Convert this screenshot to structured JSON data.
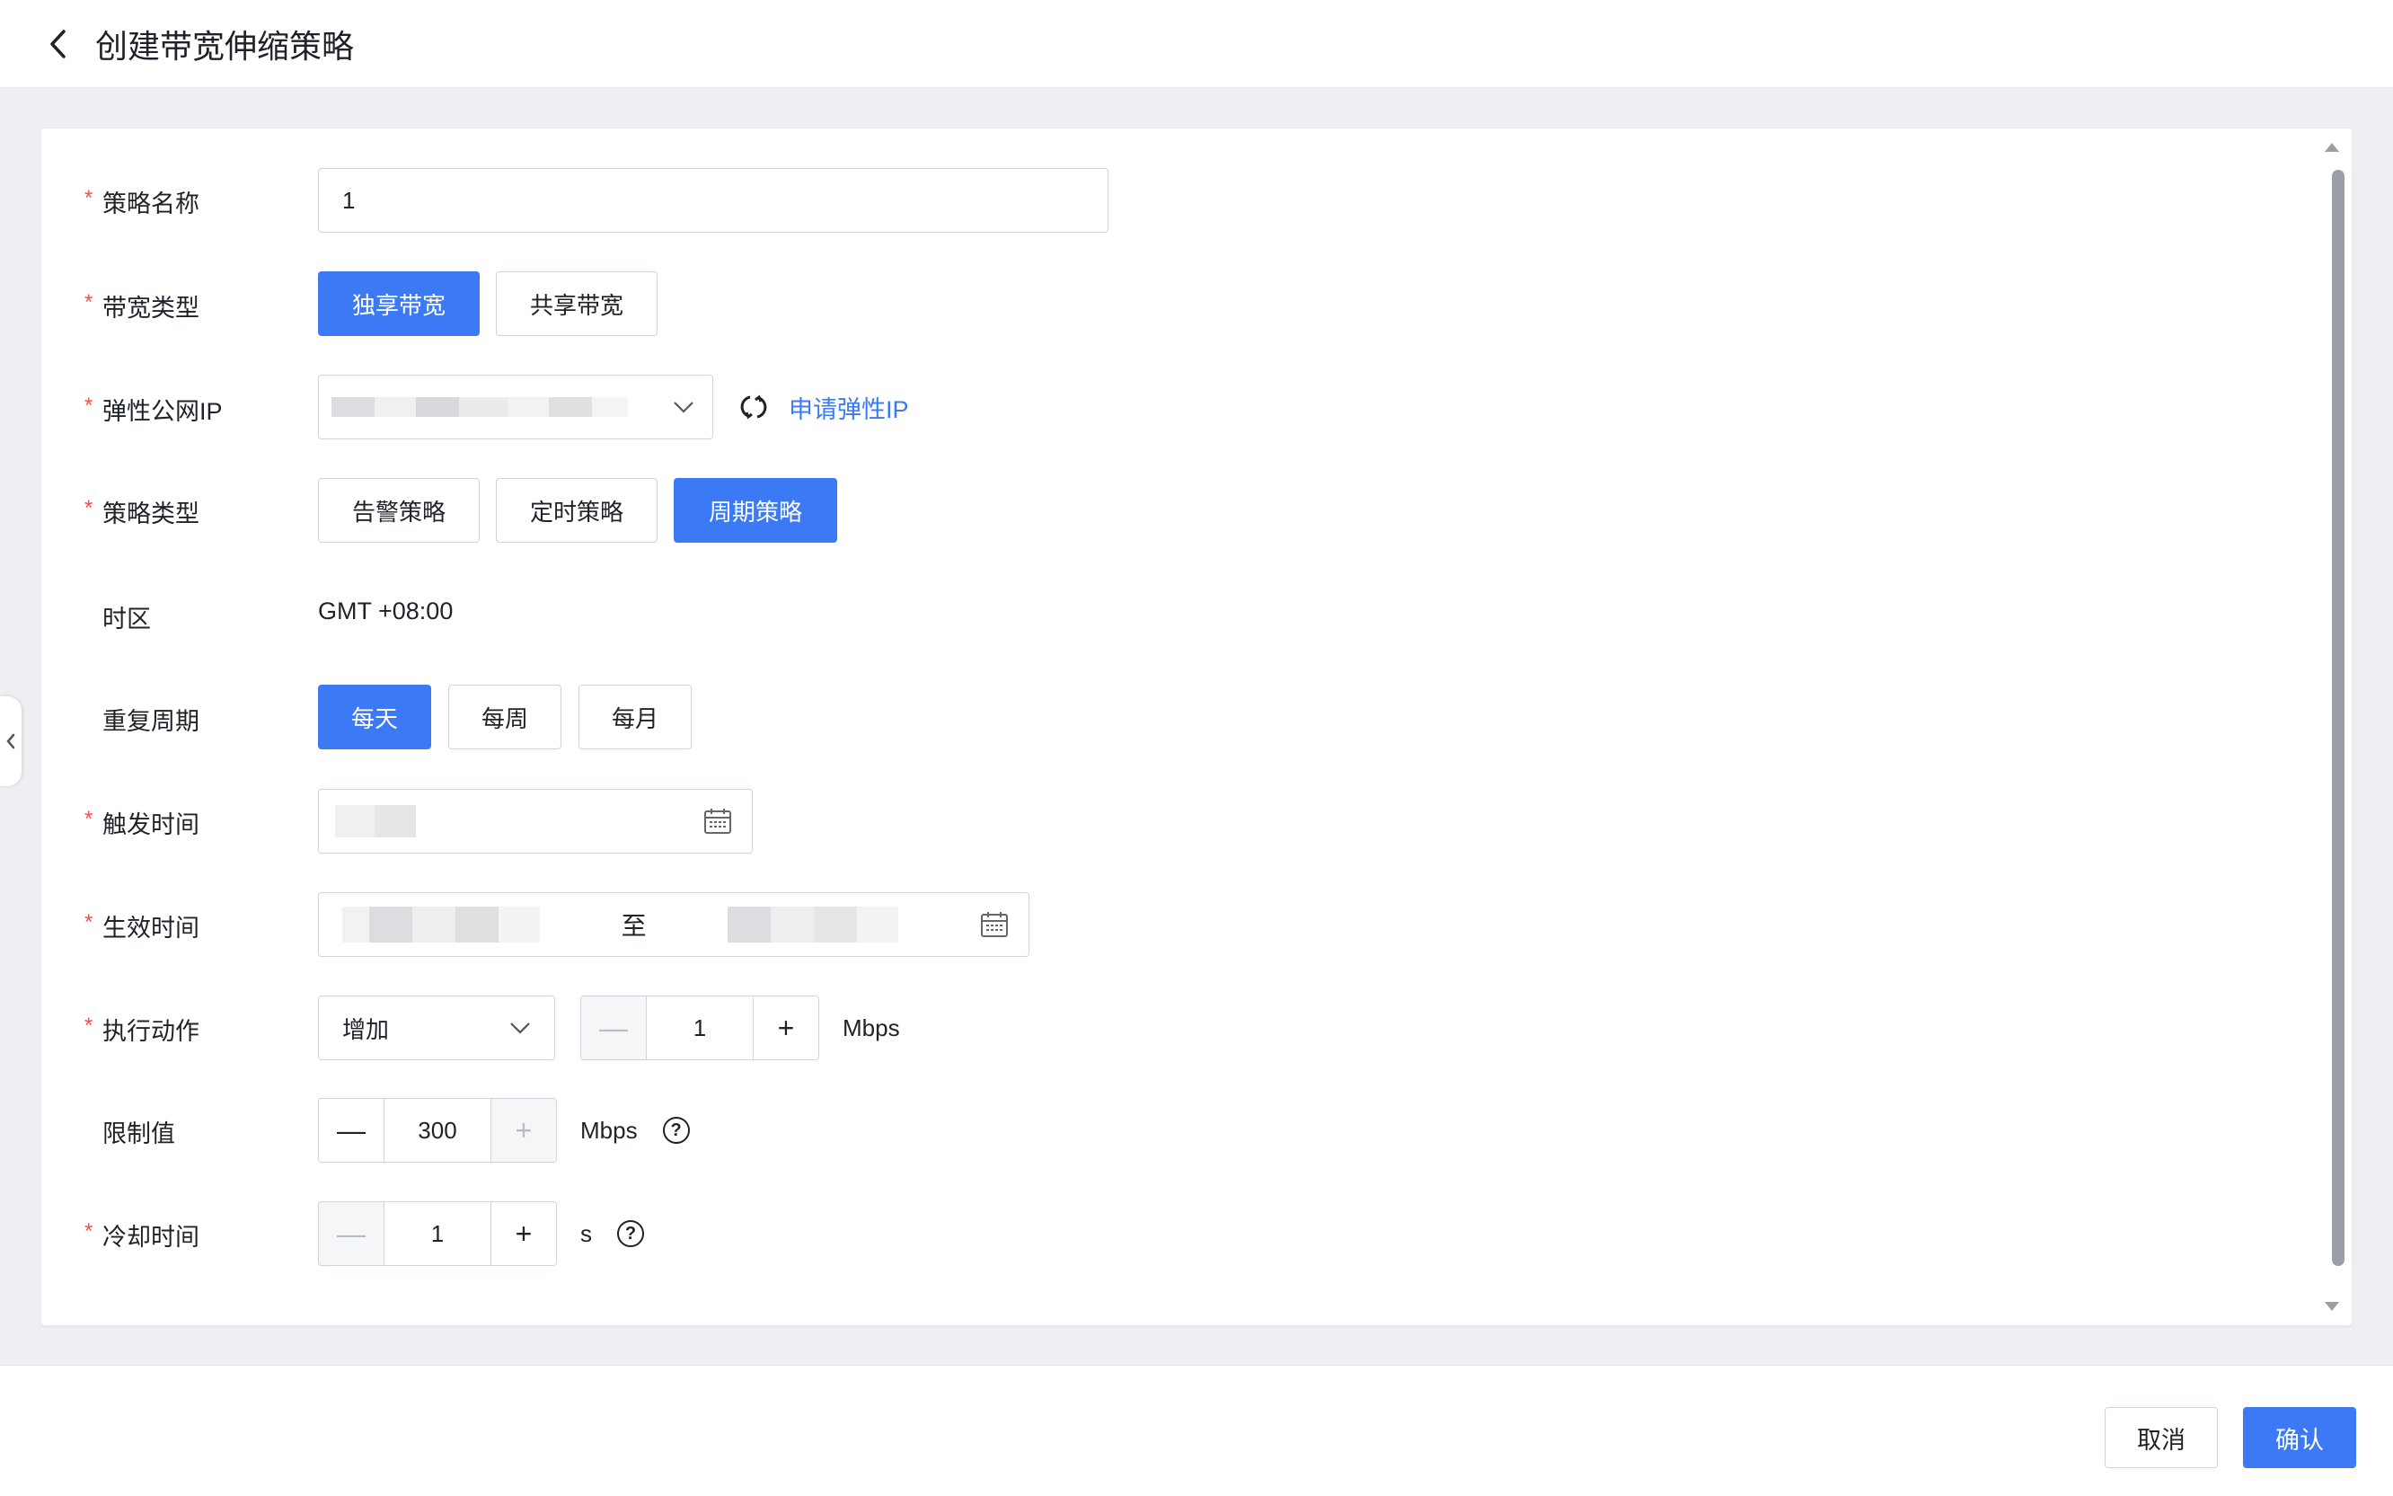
{
  "header": {
    "title": "创建带宽伸缩策略"
  },
  "form": {
    "policy_name": {
      "label": "策略名称",
      "value": "1"
    },
    "bandwidth_type": {
      "label": "带宽类型",
      "options": [
        "独享带宽",
        "共享带宽"
      ],
      "selected": "独享带宽"
    },
    "eip": {
      "label": "弹性公网IP",
      "apply_link": "申请弹性IP"
    },
    "policy_type": {
      "label": "策略类型",
      "options": [
        "告警策略",
        "定时策略",
        "周期策略"
      ],
      "selected": "周期策略"
    },
    "timezone": {
      "label": "时区",
      "value": "GMT +08:00"
    },
    "repeat_cycle": {
      "label": "重复周期",
      "options": [
        "每天",
        "每周",
        "每月"
      ],
      "selected": "每天"
    },
    "trigger_time": {
      "label": "触发时间"
    },
    "effective_time": {
      "label": "生效时间",
      "separator": "至"
    },
    "action": {
      "label": "执行动作",
      "selected": "增加",
      "amount": "1",
      "unit": "Mbps"
    },
    "limit": {
      "label": "限制值",
      "value": "300",
      "unit": "Mbps"
    },
    "cooldown": {
      "label": "冷却时间",
      "value": "1",
      "unit": "s"
    }
  },
  "footer": {
    "cancel_label": "取消",
    "confirm_label": "确认"
  },
  "colors": {
    "primary": "#3c79f5",
    "required": "#f0534b"
  }
}
